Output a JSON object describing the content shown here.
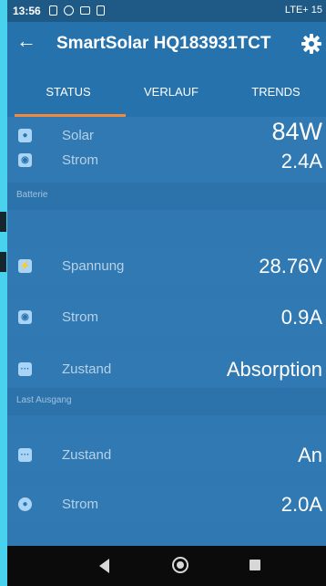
{
  "status_bar": {
    "time": "13:56",
    "right_text": "LTE+ 15"
  },
  "app_bar": {
    "back_glyph": "←",
    "title": "SmartSolar HQ183931TCT",
    "settings_icon": "gear-icon"
  },
  "tabs": [
    {
      "label": "STATUS",
      "selected": true
    },
    {
      "label": "VERLAUF",
      "selected": false
    },
    {
      "label": "TRENDS",
      "selected": false
    }
  ],
  "rows_top": [
    {
      "label": "Solar",
      "value": "84W",
      "icon": "solar-icon",
      "glyph": "●"
    },
    {
      "label": "Strom",
      "value": "2.4A",
      "icon": "current-icon",
      "glyph": "◉"
    }
  ],
  "sections": {
    "battery": {
      "title": "Batterie",
      "rows": [
        {
          "label": "Spannung",
          "value": "28.76V",
          "icon": "voltage-icon",
          "glyph": "⚡"
        },
        {
          "label": "Strom",
          "value": "0.9A",
          "icon": "current-icon",
          "glyph": "◉"
        },
        {
          "label": "Zustand",
          "value": "Absorption",
          "icon": "state-icon",
          "glyph": "···"
        }
      ]
    },
    "load": {
      "title": "Last Ausgang",
      "rows": [
        {
          "label": "Zustand",
          "value": "An",
          "icon": "state-icon",
          "glyph": "···"
        },
        {
          "label": "Strom",
          "value": "2.0A",
          "icon": "bulb-icon",
          "glyph": "●"
        }
      ]
    }
  },
  "colors": {
    "accent": "#f28a3b",
    "header": "#2672ad",
    "background": "#48d2ee"
  }
}
